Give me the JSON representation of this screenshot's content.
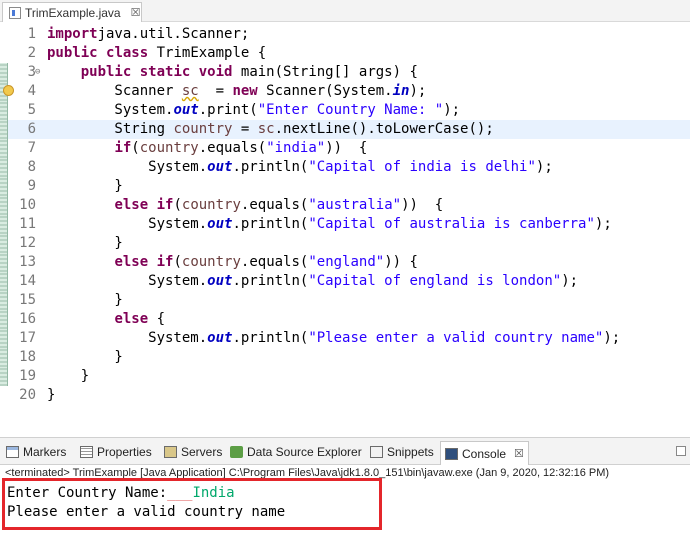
{
  "editor_tab": {
    "title": "TrimExample.java",
    "close": "☒"
  },
  "code_lines": [
    {
      "num": "1",
      "parts": [
        [
          "kw",
          "import"
        ],
        [
          "",
          "java.util.Scanner;"
        ]
      ]
    },
    {
      "num": "2",
      "parts": [
        [
          "kw",
          "public"
        ],
        [
          "",
          " "
        ],
        [
          "kw",
          "class"
        ],
        [
          "",
          " TrimExample {"
        ]
      ]
    },
    {
      "num": "3",
      "fold": "⊖",
      "parts": [
        [
          "",
          "    "
        ],
        [
          "kw",
          "public"
        ],
        [
          "",
          " "
        ],
        [
          "kw",
          "static"
        ],
        [
          "",
          " "
        ],
        [
          "kw",
          "void"
        ],
        [
          "",
          " main(String[] args) {"
        ]
      ]
    },
    {
      "num": "4",
      "warn": true,
      "parts": [
        [
          "",
          "        Scanner "
        ],
        [
          "var squiggle",
          "sc"
        ],
        [
          "",
          "  = "
        ],
        [
          "kw",
          "new"
        ],
        [
          "",
          " Scanner(System."
        ],
        [
          "fld",
          "in"
        ],
        [
          "",
          ");"
        ]
      ]
    },
    {
      "num": "5",
      "parts": [
        [
          "",
          "        System."
        ],
        [
          "fld",
          "out"
        ],
        [
          "",
          ".print("
        ],
        [
          "str",
          "\"Enter Country Name: \""
        ],
        [
          "",
          ");"
        ]
      ]
    },
    {
      "num": "6",
      "current": true,
      "parts": [
        [
          "",
          "        String "
        ],
        [
          "var",
          "country"
        ],
        [
          "",
          " = "
        ],
        [
          "var",
          "sc"
        ],
        [
          "",
          ".nextLine().toLowerCase();"
        ]
      ]
    },
    {
      "num": "7",
      "parts": [
        [
          "",
          "        "
        ],
        [
          "kw",
          "if"
        ],
        [
          "",
          "("
        ],
        [
          "var",
          "country"
        ],
        [
          "",
          ".equals("
        ],
        [
          "str",
          "\"india\""
        ],
        [
          "",
          "))  {"
        ]
      ]
    },
    {
      "num": "8",
      "parts": [
        [
          "",
          "            System."
        ],
        [
          "fld",
          "out"
        ],
        [
          "",
          ".println("
        ],
        [
          "str",
          "\"Capital of india is delhi\""
        ],
        [
          "",
          ");"
        ]
      ]
    },
    {
      "num": "9",
      "parts": [
        [
          "",
          "        }"
        ]
      ]
    },
    {
      "num": "10",
      "parts": [
        [
          "",
          "        "
        ],
        [
          "kw",
          "else"
        ],
        [
          "",
          " "
        ],
        [
          "kw",
          "if"
        ],
        [
          "",
          "("
        ],
        [
          "var",
          "country"
        ],
        [
          "",
          ".equals("
        ],
        [
          "str",
          "\"australia\""
        ],
        [
          "",
          "))  {"
        ]
      ]
    },
    {
      "num": "11",
      "parts": [
        [
          "",
          "            System."
        ],
        [
          "fld",
          "out"
        ],
        [
          "",
          ".println("
        ],
        [
          "str",
          "\"Capital of australia is canberra\""
        ],
        [
          "",
          ");"
        ]
      ]
    },
    {
      "num": "12",
      "parts": [
        [
          "",
          "        }"
        ]
      ]
    },
    {
      "num": "13",
      "parts": [
        [
          "",
          "        "
        ],
        [
          "kw",
          "else"
        ],
        [
          "",
          " "
        ],
        [
          "kw",
          "if"
        ],
        [
          "",
          "("
        ],
        [
          "var",
          "country"
        ],
        [
          "",
          ".equals("
        ],
        [
          "str",
          "\"england\""
        ],
        [
          "",
          ")) {"
        ]
      ]
    },
    {
      "num": "14",
      "parts": [
        [
          "",
          "            System."
        ],
        [
          "fld",
          "out"
        ],
        [
          "",
          ".println("
        ],
        [
          "str",
          "\"Capital of england is london\""
        ],
        [
          "",
          ");"
        ]
      ]
    },
    {
      "num": "15",
      "parts": [
        [
          "",
          "        }"
        ]
      ]
    },
    {
      "num": "16",
      "parts": [
        [
          "",
          "        "
        ],
        [
          "kw",
          "else"
        ],
        [
          "",
          " {"
        ]
      ]
    },
    {
      "num": "17",
      "parts": [
        [
          "",
          "            System."
        ],
        [
          "fld",
          "out"
        ],
        [
          "",
          ".println("
        ],
        [
          "str",
          "\"Please enter a valid country name\""
        ],
        [
          "",
          ");"
        ]
      ]
    },
    {
      "num": "18",
      "parts": [
        [
          "",
          "        }"
        ]
      ]
    },
    {
      "num": "19",
      "parts": [
        [
          "",
          "    }"
        ]
      ]
    },
    {
      "num": "20",
      "parts": [
        [
          "",
          "}"
        ]
      ]
    }
  ],
  "views": {
    "markers": "Markers",
    "properties": "Properties",
    "servers": "Servers",
    "data_source_explorer": "Data Source Explorer",
    "snippets": "Snippets",
    "console": "Console",
    "console_close": "☒"
  },
  "console": {
    "status": "<terminated> TrimExample [Java Application] C:\\Program Files\\Java\\jdk1.8.0_151\\bin\\javaw.exe (Jan 9, 2020, 12:32:16 PM)",
    "line1_prompt": "Enter Country Name:",
    "line1_spaces": "___",
    "line1_input": "India",
    "line2": "Please enter a valid country name"
  },
  "colors": {
    "keyword": "#7f0055",
    "string": "#2a00ff",
    "field": "#0000c0",
    "user_input": "#00a86b",
    "highlight_box": "#e4262b"
  }
}
